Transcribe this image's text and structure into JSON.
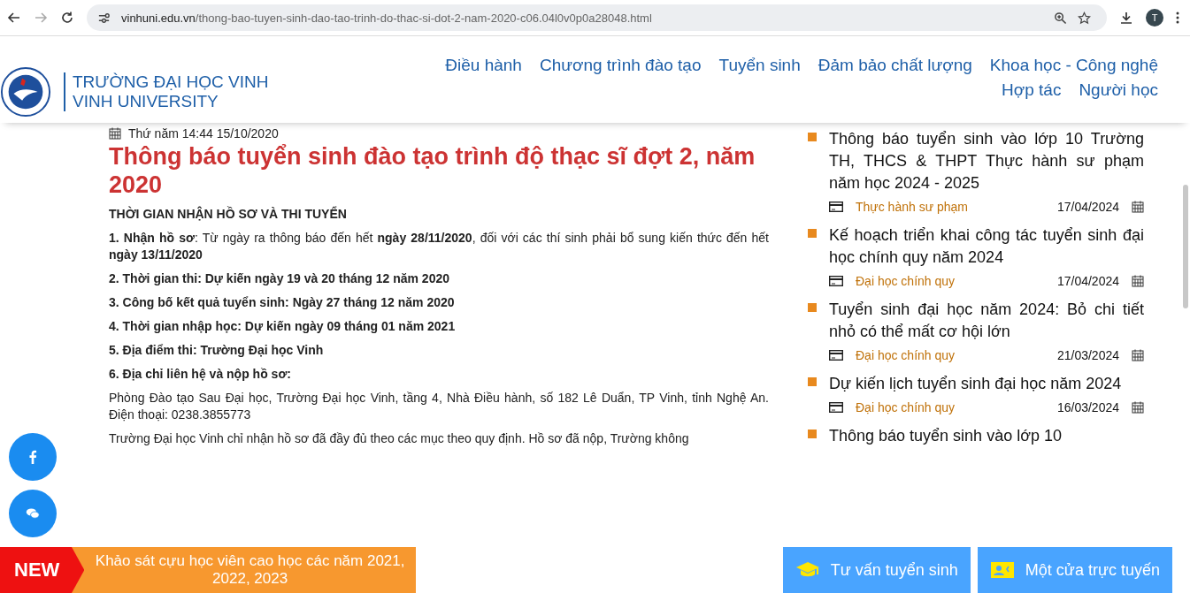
{
  "browser": {
    "url_host": "vinhuni.edu.vn",
    "url_path": "/thong-bao-tuyen-sinh-dao-tao-trinh-do-thac-si-dot-2-nam-2020-c06.04l0v0p0a28048.html",
    "profile_initial": "T"
  },
  "header": {
    "school_name": "TRƯỜNG ĐẠI HỌC VINH",
    "school_name_en": "VINH UNIVERSITY",
    "nav": [
      "Điều hành",
      "Chương trình đào tạo",
      "Tuyển sinh",
      "Đảm bảo chất lượng",
      "Khoa học - Công nghệ",
      "Hợp tác",
      "Người học"
    ]
  },
  "article": {
    "date": "Thứ năm  14:44 15/10/2020",
    "title": "Thông báo tuyển sinh đào tạo trình độ thạc sĩ đợt 2, năm 2020",
    "paragraphs": [
      {
        "kind": "heading",
        "text": "THỜI GIAN NHẬN HỒ SƠ VÀ THI TUYỂN"
      },
      {
        "kind": "text",
        "text": "**1. Nhận hồ sơ**: Từ ngày ra thông báo đến hết **ngày 28/11/2020**, đối với các thí sinh phải bổ sung kiến thức đến hết **ngày 13/11/2020**"
      },
      {
        "kind": "heading",
        "text": "2. Thời gian thi: Dự kiến ngày 19 và 20 tháng 12 năm 2020"
      },
      {
        "kind": "heading",
        "text": "3. Công bố kết quả tuyển sinh: Ngày 27 tháng 12 năm 2020"
      },
      {
        "kind": "heading",
        "text": "4. Thời gian nhập học: Dự kiến ngày 09 tháng 01 năm 2021"
      },
      {
        "kind": "text",
        "text": "**5. Địa điểm thi:** **Trường Đại học Vinh**"
      },
      {
        "kind": "heading",
        "text": "6. Địa chỉ liên hệ và nộp hồ sơ:"
      },
      {
        "kind": "text",
        "text": "Phòng Đào tạo Sau Đại học, Trường Đại học Vinh, tầng 4, Nhà Điều hành, số 182 Lê Duẩn, TP Vinh, tỉnh Nghệ An. Điện thoại: 0238.3855773"
      },
      {
        "kind": "text",
        "text": "Trường Đại học Vinh chỉ nhận hồ sơ đã đầy đủ theo các mục theo quy định. Hồ sơ đã nộp, Trường không"
      }
    ]
  },
  "sidebar": [
    {
      "title": "Thông báo tuyển sinh vào lớp 10 Trường TH, THCS & THPT Thực hành sư phạm năm học 2024 - 2025",
      "category": "Thực hành sư phạm",
      "date": "17/04/2024"
    },
    {
      "title": "Kế hoạch triển khai công tác tuyển sinh đại học chính quy năm 2024",
      "category": "Đại học chính quy",
      "date": "17/04/2024"
    },
    {
      "title": "Tuyển sinh đại học năm 2024: Bỏ chi tiết nhỏ có thể mất cơ hội lớn",
      "category": "Đại học chính quy",
      "date": "21/03/2024"
    },
    {
      "title": "Dự kiến lịch tuyển sinh đại học năm 2024",
      "category": "Đại học chính quy",
      "date": "16/03/2024"
    },
    {
      "title": "Thông báo tuyển sinh vào lớp 10"
    }
  ],
  "bottom": {
    "badge": "NEW",
    "notice": "Khảo sát cựu học viên cao học các năm 2021, 2022, 2023",
    "buttons": [
      {
        "kind": "advice",
        "label": "Tư vấn tuyển sinh"
      },
      {
        "kind": "online",
        "label": "Một cửa trực tuyến"
      }
    ]
  }
}
